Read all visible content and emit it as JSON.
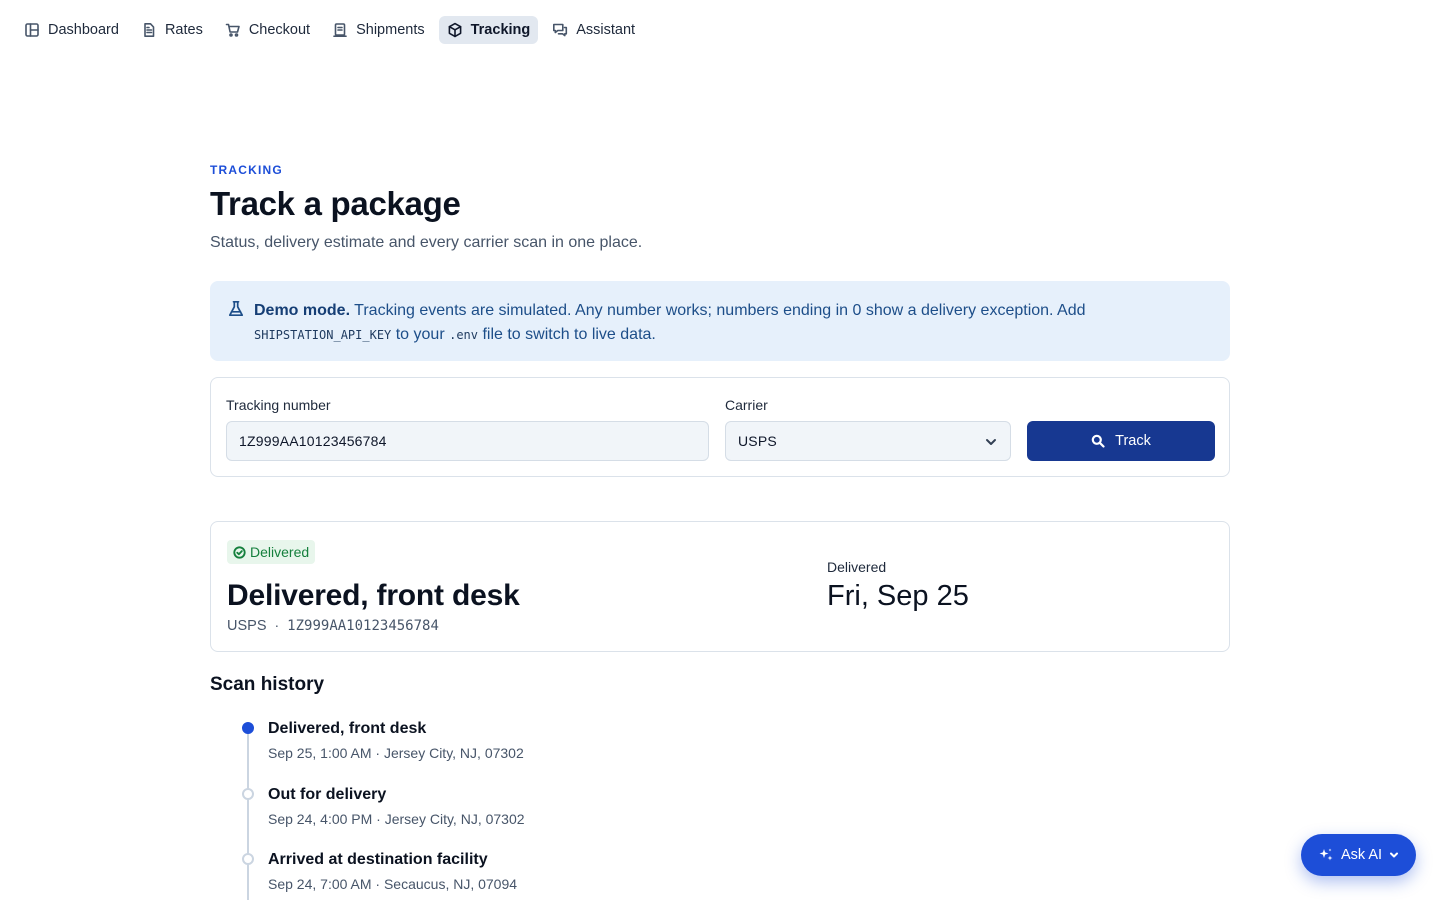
{
  "nav": {
    "items": [
      {
        "label": "Dashboard",
        "icon": "layout-icon",
        "active": false
      },
      {
        "label": "Rates",
        "icon": "document-icon",
        "active": false
      },
      {
        "label": "Checkout",
        "icon": "cart-icon",
        "active": false
      },
      {
        "label": "Shipments",
        "icon": "clipboard-icon",
        "active": false
      },
      {
        "label": "Tracking",
        "icon": "package-icon",
        "active": true
      },
      {
        "label": "Assistant",
        "icon": "chat-icon",
        "active": false
      }
    ]
  },
  "header": {
    "eyebrow": "TRACKING",
    "title": "Track a package",
    "subtitle": "Status, delivery estimate and every carrier scan in one place."
  },
  "banner": {
    "strong": "Demo mode.",
    "text1": " Tracking events are simulated. Any number works; numbers ending in 0 show a delivery exception. Add ",
    "code1": "SHIPSTATION_API_KEY",
    "text2": " to your ",
    "code2": ".env",
    "text3": " file to switch to live data."
  },
  "form": {
    "tracking_label": "Tracking number",
    "tracking_value": "1Z999AA10123456784",
    "carrier_label": "Carrier",
    "carrier_value": "USPS",
    "track_button": "Track"
  },
  "status": {
    "badge": "Delivered",
    "title": "Delivered, front desk",
    "carrier": "USPS",
    "separator": "·",
    "tracking_number": "1Z999AA10123456784",
    "delivered_label": "Delivered",
    "delivered_date": "Fri, Sep 25"
  },
  "history": {
    "title": "Scan history",
    "events": [
      {
        "title": "Delivered, front desk",
        "sub": "Sep 25, 1:00 AM · Jersey City, NJ, 07302"
      },
      {
        "title": "Out for delivery",
        "sub": "Sep 24, 4:00 PM · Jersey City, NJ, 07302"
      },
      {
        "title": "Arrived at destination facility",
        "sub": "Sep 24, 7:00 AM · Secaucus, NJ, 07094"
      }
    ]
  },
  "assistant": {
    "label": "Ask AI"
  },
  "colors": {
    "primary": "#1d4ed8",
    "button_dark": "#173891",
    "success": "#15803d",
    "banner_bg": "#e6f0fb"
  }
}
